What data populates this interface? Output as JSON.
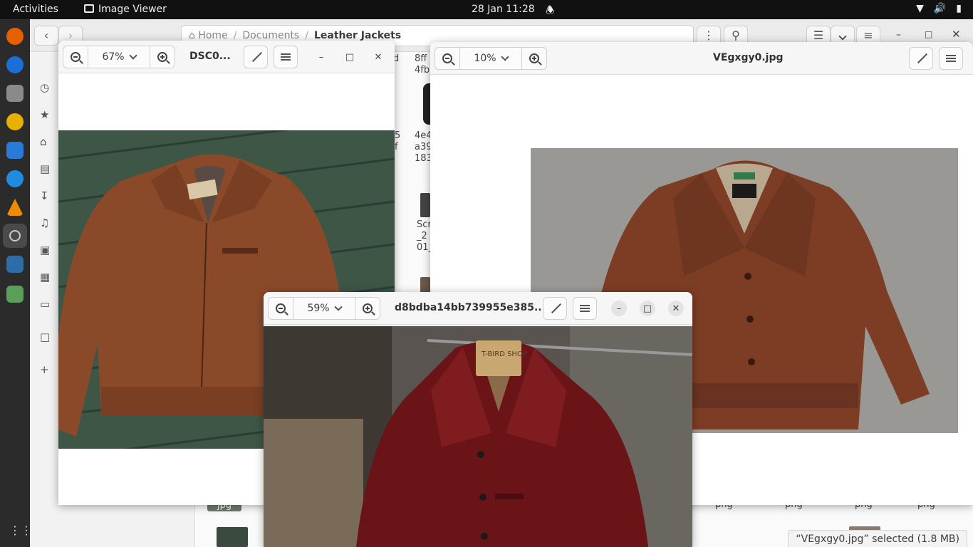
{
  "topbar": {
    "activities": "Activities",
    "app_name": "Image Viewer",
    "clock": "28 Jan  11:28",
    "icons": [
      "bell-icon",
      "wifi-icon",
      "volume-icon",
      "battery-icon"
    ]
  },
  "file_manager": {
    "path": {
      "home": "Home",
      "documents": "Documents",
      "current": "Leather Jackets"
    },
    "visible_name_fragments": [
      {
        "text": "d",
        "col": "a"
      },
      {
        "text": "8ff",
        "col": "b"
      },
      {
        "text": "4fb",
        "col": "b"
      },
      {
        "text": "5",
        "col": "a"
      },
      {
        "text": "f",
        "col": "a"
      },
      {
        "text": "4e4",
        "col": "b"
      },
      {
        "text": "a39",
        "col": "b"
      },
      {
        "text": "183",
        "col": "b"
      },
      {
        "text": "Scr",
        "col": "b"
      },
      {
        "text": "_2",
        "col": "b"
      },
      {
        "text": "01_",
        "col": "b"
      }
    ],
    "bottom_labels": [
      "jpg",
      "png",
      "png",
      "png",
      "png"
    ],
    "status": "“VEgxgy0.jpg” selected  (1.8 MB)"
  },
  "viewers": [
    {
      "title": "DSC0...",
      "zoom": "67%"
    },
    {
      "title": "VEgxgy0.jpg",
      "zoom": "10%"
    },
    {
      "title": "d8bdba14bb739955e385...",
      "zoom": "59%"
    }
  ],
  "photo_text": {
    "tag_shop": "T-BIRD SHOP"
  },
  "colors": {
    "topbar": "#111111",
    "dock": "#2b2b2b",
    "jacket_brown": "#8a4a2a",
    "jacket_oxblood": "#6a1418",
    "floor_green": "#3d5646"
  }
}
